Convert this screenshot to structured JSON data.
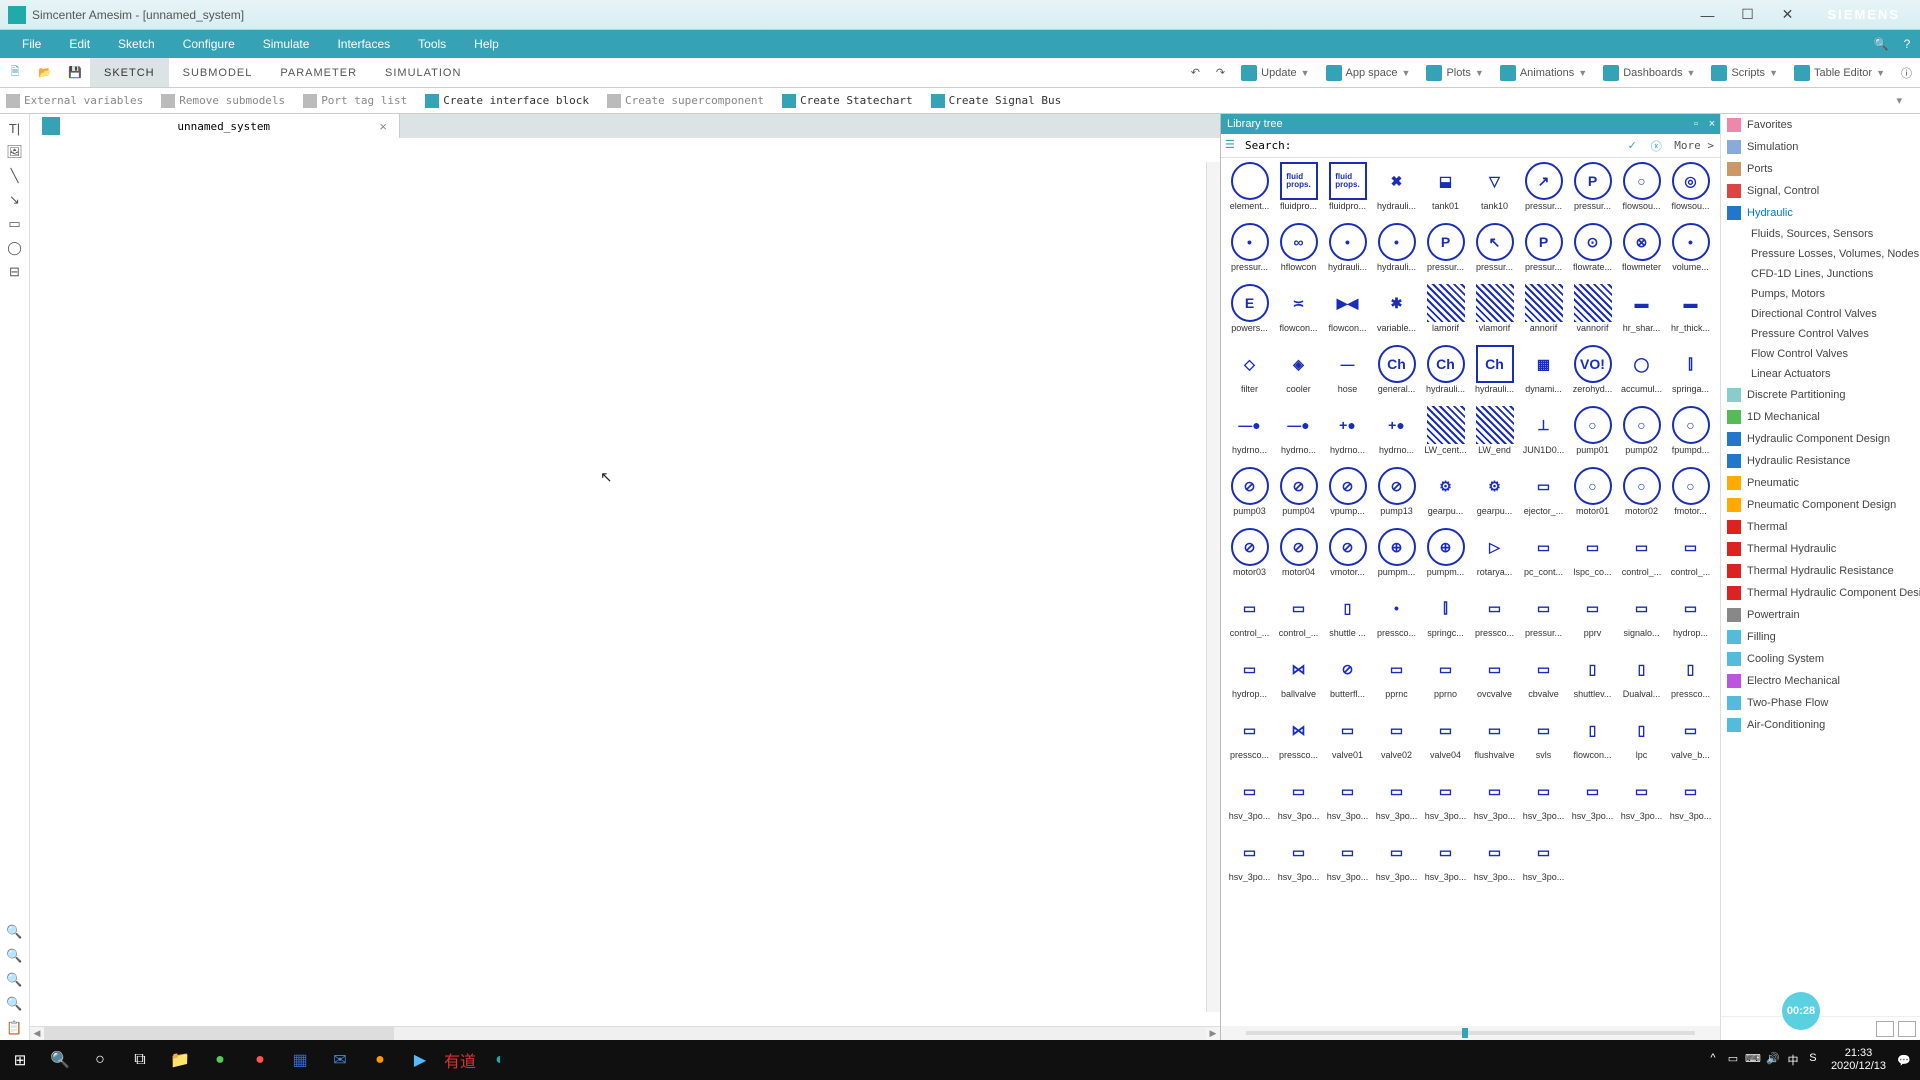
{
  "titlebar": {
    "text": "Simcenter Amesim - [unnamed_system]",
    "brand": "SIEMENS"
  },
  "menubar": {
    "items": [
      "File",
      "Edit",
      "Sketch",
      "Configure",
      "Simulate",
      "Interfaces",
      "Tools",
      "Help"
    ]
  },
  "ribbon": {
    "tabs": [
      "SKETCH",
      "SUBMODEL",
      "PARAMETER",
      "SIMULATION"
    ],
    "activeTab": 0,
    "right": [
      {
        "label": "Update"
      },
      {
        "label": "App space"
      },
      {
        "label": "Plots"
      },
      {
        "label": "Animations"
      },
      {
        "label": "Dashboards"
      },
      {
        "label": "Scripts"
      },
      {
        "label": "Table Editor"
      }
    ]
  },
  "toolbar2": [
    {
      "label": "External variables",
      "enabled": false
    },
    {
      "label": "Remove submodels",
      "enabled": false
    },
    {
      "label": "Port tag list",
      "enabled": false
    },
    {
      "label": "Create interface block",
      "enabled": true
    },
    {
      "label": "Create supercomponent",
      "enabled": false
    },
    {
      "label": "Create Statechart",
      "enabled": true
    },
    {
      "label": "Create Signal Bus",
      "enabled": true
    }
  ],
  "doctab": {
    "title": "unnamed_system"
  },
  "libtree": {
    "title": "Library tree",
    "searchLabel": "Search:",
    "more": "More >"
  },
  "components": [
    {
      "l": "element...",
      "s": "round"
    },
    {
      "l": "fluidpro...",
      "s": "box",
      "t": "fluid\\nprops."
    },
    {
      "l": "fluidpro...",
      "s": "box",
      "t": "fluid\\nprops."
    },
    {
      "l": "hydrauli...",
      "s": "none",
      "t": "✖"
    },
    {
      "l": "tank01",
      "s": "none",
      "t": "⬓"
    },
    {
      "l": "tank10",
      "s": "none",
      "t": "▽"
    },
    {
      "l": "pressur...",
      "s": "round",
      "t": "↗"
    },
    {
      "l": "pressur...",
      "s": "round",
      "t": "P"
    },
    {
      "l": "flowsou...",
      "s": "round",
      "t": "○"
    },
    {
      "l": "flowsou...",
      "s": "round",
      "t": "◎"
    },
    {
      "l": "pressur...",
      "s": "round",
      "t": "•"
    },
    {
      "l": "hflowcon",
      "s": "round",
      "t": "∞"
    },
    {
      "l": "hydrauli...",
      "s": "round",
      "t": "•"
    },
    {
      "l": "hydrauli...",
      "s": "round",
      "t": "•"
    },
    {
      "l": "pressur...",
      "s": "round",
      "t": "P"
    },
    {
      "l": "pressur...",
      "s": "round",
      "t": "↖"
    },
    {
      "l": "pressur...",
      "s": "round",
      "t": "P"
    },
    {
      "l": "flowrate...",
      "s": "round",
      "t": "⊙"
    },
    {
      "l": "flowmeter",
      "s": "round",
      "t": "⊗"
    },
    {
      "l": "volume...",
      "s": "round",
      "t": "•"
    },
    {
      "l": "powers...",
      "s": "round",
      "t": "E"
    },
    {
      "l": "flowcon...",
      "s": "none",
      "t": "≍"
    },
    {
      "l": "flowcon...",
      "s": "none",
      "t": "▶◀"
    },
    {
      "l": "variable...",
      "s": "none",
      "t": "✱"
    },
    {
      "l": "lamorif",
      "s": "none",
      "h": true
    },
    {
      "l": "vlamorif",
      "s": "none",
      "h": true
    },
    {
      "l": "annorif",
      "s": "none",
      "h": true
    },
    {
      "l": "vannorif",
      "s": "none",
      "h": true
    },
    {
      "l": "hr_shar...",
      "s": "none",
      "t": "▬"
    },
    {
      "l": "hr_thick...",
      "s": "none",
      "t": "▬"
    },
    {
      "l": "filter",
      "s": "none",
      "t": "◇"
    },
    {
      "l": "cooler",
      "s": "none",
      "t": "◈"
    },
    {
      "l": "hose",
      "s": "none",
      "t": "—"
    },
    {
      "l": "general...",
      "s": "round",
      "t": "Ch"
    },
    {
      "l": "hydrauli...",
      "s": "round",
      "t": "Ch"
    },
    {
      "l": "hydrauli...",
      "s": "box",
      "t": "Ch"
    },
    {
      "l": "dynami...",
      "s": "none",
      "t": "▦"
    },
    {
      "l": "zerohyd...",
      "s": "round",
      "t": "VO!"
    },
    {
      "l": "accumul...",
      "s": "none",
      "t": "◯"
    },
    {
      "l": "springa...",
      "s": "none",
      "t": "⫿"
    },
    {
      "l": "hydrno...",
      "s": "none",
      "t": "—●"
    },
    {
      "l": "hydrno...",
      "s": "none",
      "t": "—●"
    },
    {
      "l": "hydrno...",
      "s": "none",
      "t": "+●"
    },
    {
      "l": "hydrno...",
      "s": "none",
      "t": "+●"
    },
    {
      "l": "LW_cent...",
      "s": "none",
      "h": true
    },
    {
      "l": "LW_end",
      "s": "none",
      "h": true
    },
    {
      "l": "JUN1D0...",
      "s": "none",
      "t": "⊥"
    },
    {
      "l": "pump01",
      "s": "round",
      "t": "○"
    },
    {
      "l": "pump02",
      "s": "round",
      "t": "○"
    },
    {
      "l": "fpumpd...",
      "s": "round",
      "t": "○"
    },
    {
      "l": "pump03",
      "s": "round",
      "t": "⊘"
    },
    {
      "l": "pump04",
      "s": "round",
      "t": "⊘"
    },
    {
      "l": "vpump...",
      "s": "round",
      "t": "⊘"
    },
    {
      "l": "pump13",
      "s": "round",
      "t": "⊘"
    },
    {
      "l": "gearpu...",
      "s": "none",
      "t": "⚙"
    },
    {
      "l": "gearpu...",
      "s": "none",
      "t": "⚙"
    },
    {
      "l": "ejector_...",
      "s": "none",
      "t": "▭"
    },
    {
      "l": "motor01",
      "s": "round",
      "t": "○"
    },
    {
      "l": "motor02",
      "s": "round",
      "t": "○"
    },
    {
      "l": "fmotor...",
      "s": "round",
      "t": "○"
    },
    {
      "l": "motor03",
      "s": "round",
      "t": "⊘"
    },
    {
      "l": "motor04",
      "s": "round",
      "t": "⊘"
    },
    {
      "l": "vmotor...",
      "s": "round",
      "t": "⊘"
    },
    {
      "l": "pumpm...",
      "s": "round",
      "t": "⊕"
    },
    {
      "l": "pumpm...",
      "s": "round",
      "t": "⊕"
    },
    {
      "l": "rotarya...",
      "s": "none",
      "t": "▷"
    },
    {
      "l": "pc_cont...",
      "s": "none",
      "t": "▭"
    },
    {
      "l": "lspc_co...",
      "s": "none",
      "t": "▭"
    },
    {
      "l": "control_...",
      "s": "none",
      "t": "▭"
    },
    {
      "l": "control_...",
      "s": "none",
      "t": "▭"
    },
    {
      "l": "control_...",
      "s": "none",
      "t": "▭"
    },
    {
      "l": "control_...",
      "s": "none",
      "t": "▭"
    },
    {
      "l": "shuttle ...",
      "s": "none",
      "t": "▯"
    },
    {
      "l": "pressco...",
      "s": "none",
      "t": "•"
    },
    {
      "l": "springc...",
      "s": "none",
      "t": "⫿"
    },
    {
      "l": "pressco...",
      "s": "none",
      "t": "▭"
    },
    {
      "l": "pressur...",
      "s": "none",
      "t": "▭"
    },
    {
      "l": "pprv",
      "s": "none",
      "t": "▭"
    },
    {
      "l": "signalo...",
      "s": "none",
      "t": "▭"
    },
    {
      "l": "hydrop...",
      "s": "none",
      "t": "▭"
    },
    {
      "l": "hydrop...",
      "s": "none",
      "t": "▭"
    },
    {
      "l": "ballvalve",
      "s": "none",
      "t": "⋈"
    },
    {
      "l": "butterfl...",
      "s": "none",
      "t": "⊘"
    },
    {
      "l": "pprnc",
      "s": "none",
      "t": "▭"
    },
    {
      "l": "pprno",
      "s": "none",
      "t": "▭"
    },
    {
      "l": "ovcvalve",
      "s": "none",
      "t": "▭"
    },
    {
      "l": "cbvalve",
      "s": "none",
      "t": "▭"
    },
    {
      "l": "shuttlev...",
      "s": "none",
      "t": "▯"
    },
    {
      "l": "Dualval...",
      "s": "none",
      "t": "▯"
    },
    {
      "l": "pressco...",
      "s": "none",
      "t": "▯"
    },
    {
      "l": "pressco...",
      "s": "none",
      "t": "▭"
    },
    {
      "l": "pressco...",
      "s": "none",
      "t": "⋈"
    },
    {
      "l": "valve01",
      "s": "none",
      "t": "▭"
    },
    {
      "l": "valve02",
      "s": "none",
      "t": "▭"
    },
    {
      "l": "valve04",
      "s": "none",
      "t": "▭"
    },
    {
      "l": "flushvalve",
      "s": "none",
      "t": "▭"
    },
    {
      "l": "svls",
      "s": "none",
      "t": "▭"
    },
    {
      "l": "flowcon...",
      "s": "none",
      "t": "▯"
    },
    {
      "l": "lpc",
      "s": "none",
      "t": "▯"
    },
    {
      "l": "valve_b...",
      "s": "none",
      "t": "▭"
    },
    {
      "l": "hsv_3po...",
      "s": "none",
      "t": "▭"
    },
    {
      "l": "hsv_3po...",
      "s": "none",
      "t": "▭"
    },
    {
      "l": "hsv_3po...",
      "s": "none",
      "t": "▭"
    },
    {
      "l": "hsv_3po...",
      "s": "none",
      "t": "▭"
    },
    {
      "l": "hsv_3po...",
      "s": "none",
      "t": "▭"
    },
    {
      "l": "hsv_3po...",
      "s": "none",
      "t": "▭"
    },
    {
      "l": "hsv_3po...",
      "s": "none",
      "t": "▭"
    },
    {
      "l": "hsv_3po...",
      "s": "none",
      "t": "▭"
    },
    {
      "l": "hsv_3po...",
      "s": "none",
      "t": "▭"
    },
    {
      "l": "hsv_3po...",
      "s": "none",
      "t": "▭"
    },
    {
      "l": "hsv_3po...",
      "s": "none",
      "t": "▭"
    },
    {
      "l": "hsv_3po...",
      "s": "none",
      "t": "▭"
    },
    {
      "l": "hsv_3po...",
      "s": "none",
      "t": "▭"
    },
    {
      "l": "hsv_3po...",
      "s": "none",
      "t": "▭"
    },
    {
      "l": "hsv_3po...",
      "s": "none",
      "t": "▭"
    },
    {
      "l": "hsv_3po...",
      "s": "none",
      "t": "▭"
    },
    {
      "l": "hsv_3po...",
      "s": "none",
      "t": "▭"
    }
  ],
  "categories": [
    {
      "l": "Favorites",
      "c": "#e8a"
    },
    {
      "l": "Simulation",
      "c": "#8ad"
    },
    {
      "l": "Ports",
      "c": "#c96"
    },
    {
      "l": "Signal, Control",
      "c": "#d44"
    },
    {
      "l": "Hydraulic",
      "c": "#27c",
      "active": true
    },
    {
      "l": "Fluids, Sources, Sensors",
      "sub": true
    },
    {
      "l": "Pressure Losses, Volumes, Nodes",
      "sub": true
    },
    {
      "l": "CFD-1D Lines, Junctions",
      "sub": true
    },
    {
      "l": "Pumps, Motors",
      "sub": true
    },
    {
      "l": "Directional Control Valves",
      "sub": true
    },
    {
      "l": "Pressure Control Valves",
      "sub": true
    },
    {
      "l": "Flow Control Valves",
      "sub": true
    },
    {
      "l": "Linear Actuators",
      "sub": true
    },
    {
      "l": "Discrete Partitioning",
      "c": "#8cc"
    },
    {
      "l": "1D Mechanical",
      "c": "#5b5"
    },
    {
      "l": "Hydraulic Component Design",
      "c": "#27c"
    },
    {
      "l": "Hydraulic Resistance",
      "c": "#27c"
    },
    {
      "l": "Pneumatic",
      "c": "#fa0"
    },
    {
      "l": "Pneumatic Component Design",
      "c": "#fa0"
    },
    {
      "l": "Thermal",
      "c": "#d22"
    },
    {
      "l": "Thermal Hydraulic",
      "c": "#d22"
    },
    {
      "l": "Thermal Hydraulic Resistance",
      "c": "#d22"
    },
    {
      "l": "Thermal Hydraulic Component Desi..",
      "c": "#d22"
    },
    {
      "l": "Powertrain",
      "c": "#888"
    },
    {
      "l": "Filling",
      "c": "#5bd"
    },
    {
      "l": "Cooling System",
      "c": "#5bd"
    },
    {
      "l": "Electro Mechanical",
      "c": "#b5d"
    },
    {
      "l": "Two-Phase Flow",
      "c": "#5bd"
    },
    {
      "l": "Air-Conditioning",
      "c": "#5bd"
    }
  ],
  "taskbar": {
    "apps": [
      {
        "c": "#fff",
        "t": "⊞"
      },
      {
        "c": "#fff",
        "t": "🔍"
      },
      {
        "c": "#fff",
        "t": "○"
      },
      {
        "c": "#fff",
        "t": "⧉"
      },
      {
        "c": "#ffcb4c",
        "t": "📁"
      },
      {
        "c": "#5c5",
        "t": "●"
      },
      {
        "c": "#f55",
        "t": "●"
      },
      {
        "c": "#36c",
        "t": "▦"
      },
      {
        "c": "#48d",
        "t": "✉"
      },
      {
        "c": "#f90",
        "t": "●"
      },
      {
        "c": "#5bf",
        "t": "▶"
      },
      {
        "c": "#d33",
        "t": "有道"
      },
      {
        "c": "#2aa",
        "t": "◐"
      }
    ],
    "tray": [
      "^",
      "▭",
      "⌨",
      "🔊",
      "中",
      "S"
    ],
    "time": "21:33",
    "date": "2020/12/13"
  },
  "bubble": "00:28"
}
